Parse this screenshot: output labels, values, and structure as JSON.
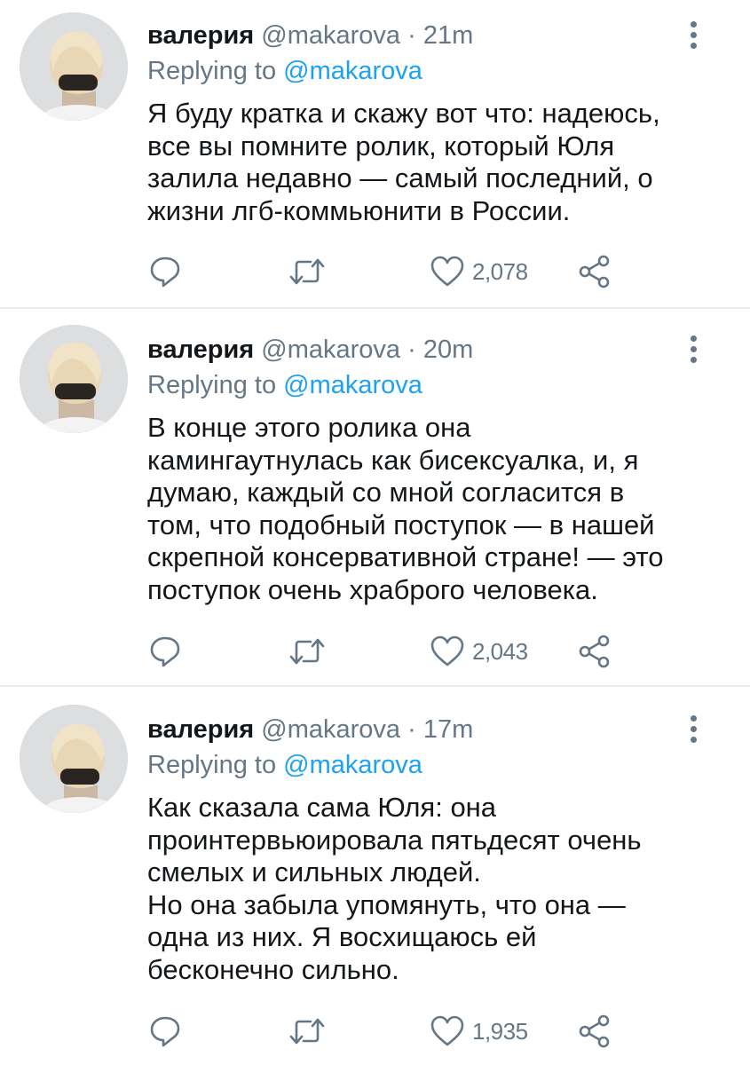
{
  "tweets": [
    {
      "author_name": "валерия",
      "handle": "@makarova",
      "separator": "·",
      "time": "21m",
      "replying_prefix": "Replying to",
      "replying_to": "@makarova",
      "text": "Я буду кратка и скажу вот что: надеюсь,\nвсе вы помните ролик, который Юля\nзалила недавно — самый последний, о\nжизни лгб-коммьюнити в России.",
      "likes": "2,078"
    },
    {
      "author_name": "валерия",
      "handle": "@makarova",
      "separator": "·",
      "time": "20m",
      "replying_prefix": "Replying to",
      "replying_to": "@makarova",
      "text": "В конце этого ролика она\nкамингаутнулась как бисексуалка, и, я\nдумаю, каждый со мной согласится в\nтом, что подобный поступок — в нашей\nскрепной консервативной стране! — это\nпоступок очень храброго человека.",
      "likes": "2,043"
    },
    {
      "author_name": "валерия",
      "handle": "@makarova",
      "separator": "·",
      "time": "17m",
      "replying_prefix": "Replying to",
      "replying_to": "@makarova",
      "text": "Как сказала сама Юля: она\nпроинтервьюировала пятьдесят очень\nсмелых и сильных людей.\nНо она забыла упомянуть, что она —\nодна из них. Я восхищаюсь ей\nбесконечно сильно.",
      "likes": "1,935"
    }
  ],
  "icons": {
    "reply": "reply-icon",
    "retweet": "retweet-icon",
    "like": "like-icon",
    "share": "share-icon",
    "more": "more-vertical-icon"
  },
  "colors": {
    "text": "#14171a",
    "muted": "#657786",
    "link": "#1da1f2",
    "divider": "#e6ecf0"
  }
}
